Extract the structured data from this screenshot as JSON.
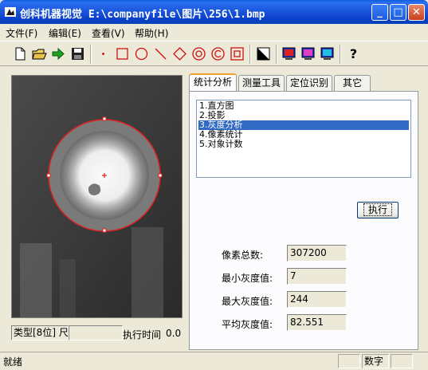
{
  "window": {
    "title": "创科机器视觉 E:\\companyfile\\图片\\256\\1.bmp",
    "min_label": "_",
    "max_label": "□",
    "close_label": "✕"
  },
  "menu": {
    "items": [
      {
        "label": "文件(F)"
      },
      {
        "label": "编辑(E)"
      },
      {
        "label": "查看(V)"
      },
      {
        "label": "帮助(H)"
      }
    ]
  },
  "toolbar": {
    "help_label": "?"
  },
  "tabs": [
    {
      "label": "统计分析",
      "active": true
    },
    {
      "label": "测量工具"
    },
    {
      "label": "定位识别"
    },
    {
      "label": "其它"
    }
  ],
  "analysis_list": [
    {
      "label": "1.直方图"
    },
    {
      "label": "2.投影"
    },
    {
      "label": "3.灰度分析",
      "selected": true
    },
    {
      "label": "4.像素统计"
    },
    {
      "label": "5.对象计数"
    }
  ],
  "execute_label": "执行",
  "stats": [
    {
      "label": "像素总数:",
      "value": "307200"
    },
    {
      "label": "最小灰度值:",
      "value": "7"
    },
    {
      "label": "最大灰度值:",
      "value": "244"
    },
    {
      "label": "平均灰度值:",
      "value": "82.551"
    }
  ],
  "info": {
    "type_text": "类型[8位] 尺",
    "time_label": "执行时间",
    "time_value": "0.0"
  },
  "status": {
    "ready": "就绪",
    "numlock": "数字"
  },
  "colors": {
    "selection": "#316ac5",
    "circle": "#e02020",
    "titlebar": "#0a3fc8"
  }
}
